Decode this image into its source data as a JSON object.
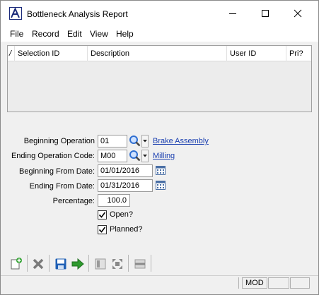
{
  "window": {
    "title": "Bottleneck Analysis Report"
  },
  "menu": [
    "File",
    "Record",
    "Edit",
    "View",
    "Help"
  ],
  "grid": {
    "columns": [
      "Selection ID",
      "Description",
      "User ID",
      "Pri?"
    ],
    "sort_indicator": "/"
  },
  "form": {
    "beginning_operation": {
      "label": "Beginning Operation",
      "value": "01",
      "link": "Brake Assembly"
    },
    "ending_operation": {
      "label": "Ending Operation Code:",
      "value": "M00",
      "link": "Milling"
    },
    "beginning_from_date": {
      "label": "Beginning From Date:",
      "value": "01/01/2016"
    },
    "ending_from_date": {
      "label": "Ending From Date:",
      "value": "01/31/2016"
    },
    "percentage": {
      "label": "Percentage:",
      "value": "100.0"
    },
    "open": {
      "label": "Open?",
      "checked": true
    },
    "planned": {
      "label": "Planned?",
      "checked": true
    }
  },
  "status": {
    "mode": "MOD"
  },
  "colors": {
    "link": "#1a3fb0",
    "search_icon": "#2f6fd1",
    "save_icon": "#1f5fb5",
    "next_icon": "#2e9a2e",
    "delete_icon": "#7a7a7a"
  }
}
